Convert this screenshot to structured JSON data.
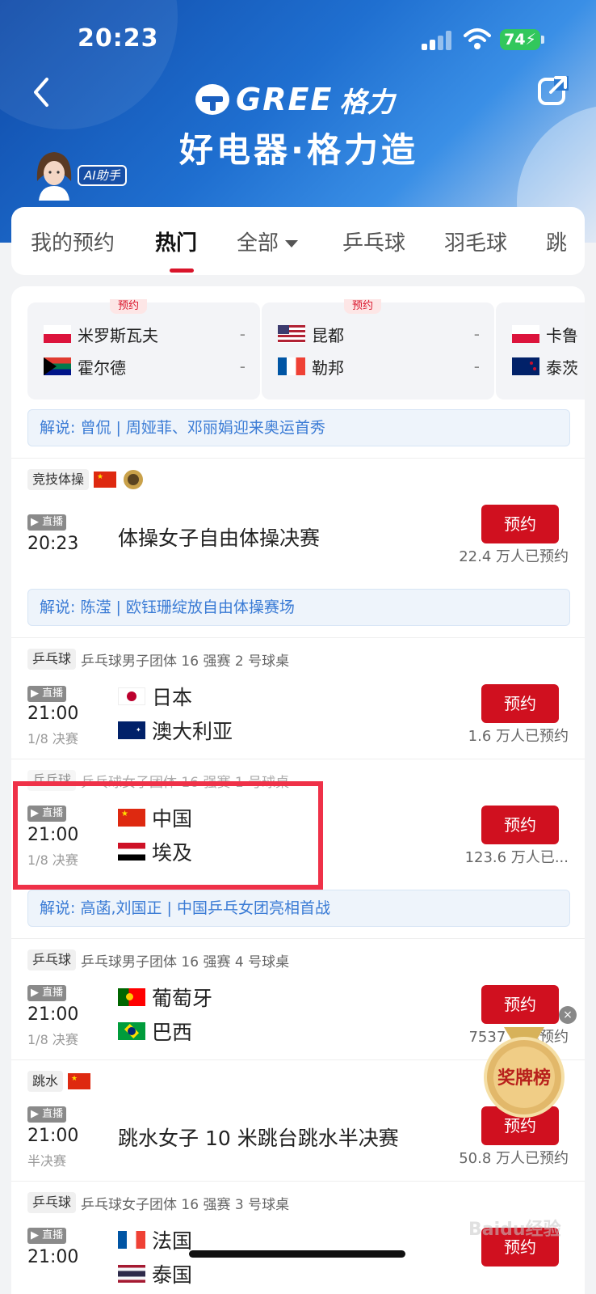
{
  "status": {
    "time": "20:23",
    "battery": "74"
  },
  "header": {
    "brand": "GREE",
    "brand_cn": "格力",
    "slogan": "好电器·格力造",
    "ai_tag": "AI助手"
  },
  "tabs": [
    {
      "label": "我的预约"
    },
    {
      "label": "热门"
    },
    {
      "label": "全部"
    },
    {
      "label": "乒乓球"
    },
    {
      "label": "羽毛球"
    },
    {
      "label": "跳"
    }
  ],
  "matchups": [
    {
      "tag": "预约",
      "team1": "米罗斯瓦夫",
      "score1": "-",
      "team2": "霍尔德",
      "score2": "-"
    },
    {
      "tag": "预约",
      "team1": "昆都",
      "score1": "-",
      "team2": "勒邦",
      "score2": "-"
    },
    {
      "team1": "卡鲁",
      "team2": "泰茨"
    }
  ],
  "commentary": [
    "解说: 曾侃 | 周娅菲、邓丽娟迎来奥运首秀",
    "解说: 陈滢 | 欧钰珊绽放自由体操赛场",
    "解说: 高菡,刘国正 | 中国乒乓女团亮相首战"
  ],
  "events": [
    {
      "sport": "竞技体操",
      "time": "20:23",
      "title": "体操女子自由体操决赛",
      "button": "预约",
      "count": "22.4 万人已预约"
    },
    {
      "sport": "乒乓球",
      "desc": "乒乓球男子团体 16 强赛 2 号球桌",
      "time": "21:00",
      "round": "1/8 决赛",
      "team1": "日本",
      "team2": "澳大利亚",
      "button": "预约",
      "count": "1.6 万人已预约"
    },
    {
      "sport": "乒乓球",
      "desc": "乒乓球女子团体 16 强赛 1 号球桌",
      "time": "21:00",
      "round": "1/8 决赛",
      "team1": "中国",
      "team2": "埃及",
      "button": "预约",
      "count": "123.6 万人已..."
    },
    {
      "sport": "乒乓球",
      "desc": "乒乓球男子团体 16 强赛 4 号球桌",
      "time": "21:00",
      "round": "1/8 决赛",
      "team1": "葡萄牙",
      "team2": "巴西",
      "button": "预约",
      "count": "7537 人已预约"
    },
    {
      "sport": "跳水",
      "time": "21:00",
      "round": "半决赛",
      "title": "跳水女子 10 米跳台跳水半决赛",
      "button": "预约",
      "count": "50.8 万人已预约"
    },
    {
      "sport": "乒乓球",
      "desc": "乒乓球女子团体 16 强赛 3 号球桌",
      "time": "21:00",
      "team1": "法国",
      "team2": "泰国",
      "button": "预约"
    }
  ],
  "live_label": "直播",
  "medal_label": "奖牌榜",
  "watermark": "Baidu经验",
  "colors": {
    "accent": "#d0101f",
    "commentary": "#3a7bd5",
    "highlight": "#ef3148"
  }
}
